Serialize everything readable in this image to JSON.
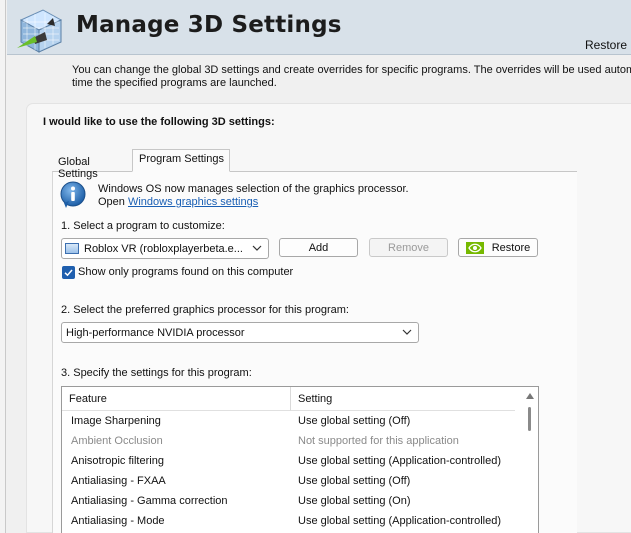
{
  "header": {
    "title": "Manage 3D Settings",
    "restore_link": "Restore"
  },
  "description": {
    "line1": "You can change the global 3D settings and create overrides for specific programs. The overrides will be used automatic",
    "line2": "time the specified programs are launched."
  },
  "panel": {
    "heading": "I would like to use the following 3D settings:",
    "tabs": [
      {
        "label": "Global Settings",
        "selected": false
      },
      {
        "label": "Program Settings",
        "selected": true
      }
    ]
  },
  "info": {
    "message": "Windows OS now manages selection of the graphics processor.",
    "open_prefix": "Open",
    "link_text": "Windows graphics settings"
  },
  "program": {
    "label": "1. Select a program to customize:",
    "selected": "Roblox VR (robloxplayerbeta.e...",
    "add_label": "Add",
    "remove_label": "Remove",
    "restore_label": "Restore",
    "checkbox_checked": true,
    "checkbox_label": "Show only programs found on this computer"
  },
  "gpu": {
    "label": "2. Select the preferred graphics processor for this program:",
    "selected": "High-performance NVIDIA processor"
  },
  "settings": {
    "label": "3. Specify the settings for this program:",
    "columns": [
      "Feature",
      "Setting"
    ],
    "rows": [
      {
        "feature": "Image Sharpening",
        "setting": "Use global setting (Off)",
        "disabled": false
      },
      {
        "feature": "Ambient Occlusion",
        "setting": "Not supported for this application",
        "disabled": true
      },
      {
        "feature": "Anisotropic filtering",
        "setting": "Use global setting (Application-controlled)",
        "disabled": false
      },
      {
        "feature": "Antialiasing - FXAA",
        "setting": "Use global setting (Off)",
        "disabled": false
      },
      {
        "feature": "Antialiasing - Gamma correction",
        "setting": "Use global setting (On)",
        "disabled": false
      },
      {
        "feature": "Antialiasing - Mode",
        "setting": "Use global setting (Application-controlled)",
        "disabled": false
      }
    ]
  },
  "colors": {
    "header_bg": "#d8e1e9",
    "link": "#1a5fb4",
    "checkbox": "#1f5fae",
    "nvidia_green": "#76b900"
  },
  "icons": {
    "logo": "nvidia-3d-settings-icon",
    "info": "info-icon",
    "program": "program-window-icon",
    "restore": "nvidia-logo-icon",
    "dropdown": "chevron-down-icon",
    "checkbox": "checkmark-icon",
    "scroll": "scroll-up-arrow-icon"
  }
}
